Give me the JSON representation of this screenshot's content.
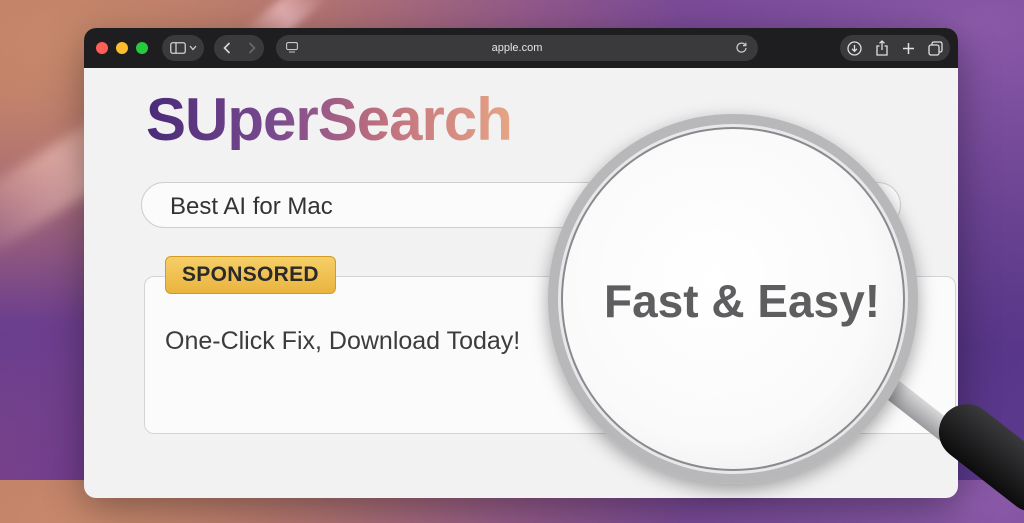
{
  "browser": {
    "url": "apple.com"
  },
  "page": {
    "logo_text": "SUperSearch",
    "search_query": "Best AI for Mac"
  },
  "ad": {
    "badge": "SPONSORED",
    "text": "One-Click Fix, Download Today!",
    "magnified_text": "Fast & Easy!"
  },
  "colors": {
    "badge": "#e9b43e",
    "titlebar": "#1e1e20",
    "logo_start": "#4a2a78",
    "logo_end": "#e6a585"
  },
  "icons": [
    "sidebar-icon",
    "chevron-down-icon",
    "back-icon",
    "forward-icon",
    "reader-icon",
    "reload-icon",
    "download-icon",
    "share-icon",
    "plus-icon",
    "tabs-icon",
    "search-icon",
    "magnifying-glass-icon"
  ]
}
